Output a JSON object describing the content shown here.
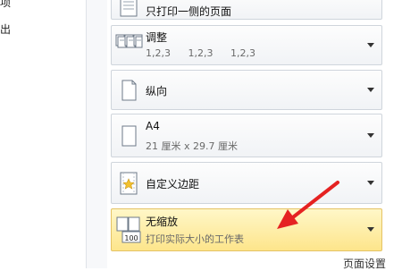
{
  "left_nav": {
    "items": [
      {
        "label": "项"
      },
      {
        "label": "出"
      }
    ]
  },
  "print_settings": {
    "sides": {
      "title": "只打印一侧的页面"
    },
    "collate": {
      "title": "调整",
      "values": [
        "1,2,3",
        "1,2,3",
        "1,2,3"
      ]
    },
    "orientation": {
      "title": "纵向"
    },
    "paper": {
      "title": "A4",
      "sub": "21 厘米 x 29.7 厘米"
    },
    "margins": {
      "title": "自定义边距"
    },
    "scaling": {
      "title": "无缩放",
      "sub": "打印实际大小的工作表",
      "icon_text": "100"
    },
    "page_setup_link": "页面设置"
  },
  "colors": {
    "active_highlight": "#fde58b",
    "annotation_arrow": "#e52222"
  },
  "icons": [
    "sides-icon",
    "collate-icon",
    "portrait-icon",
    "paper-icon",
    "custom-margins-icon",
    "no-scaling-icon",
    "dropdown-arrow-icon"
  ]
}
